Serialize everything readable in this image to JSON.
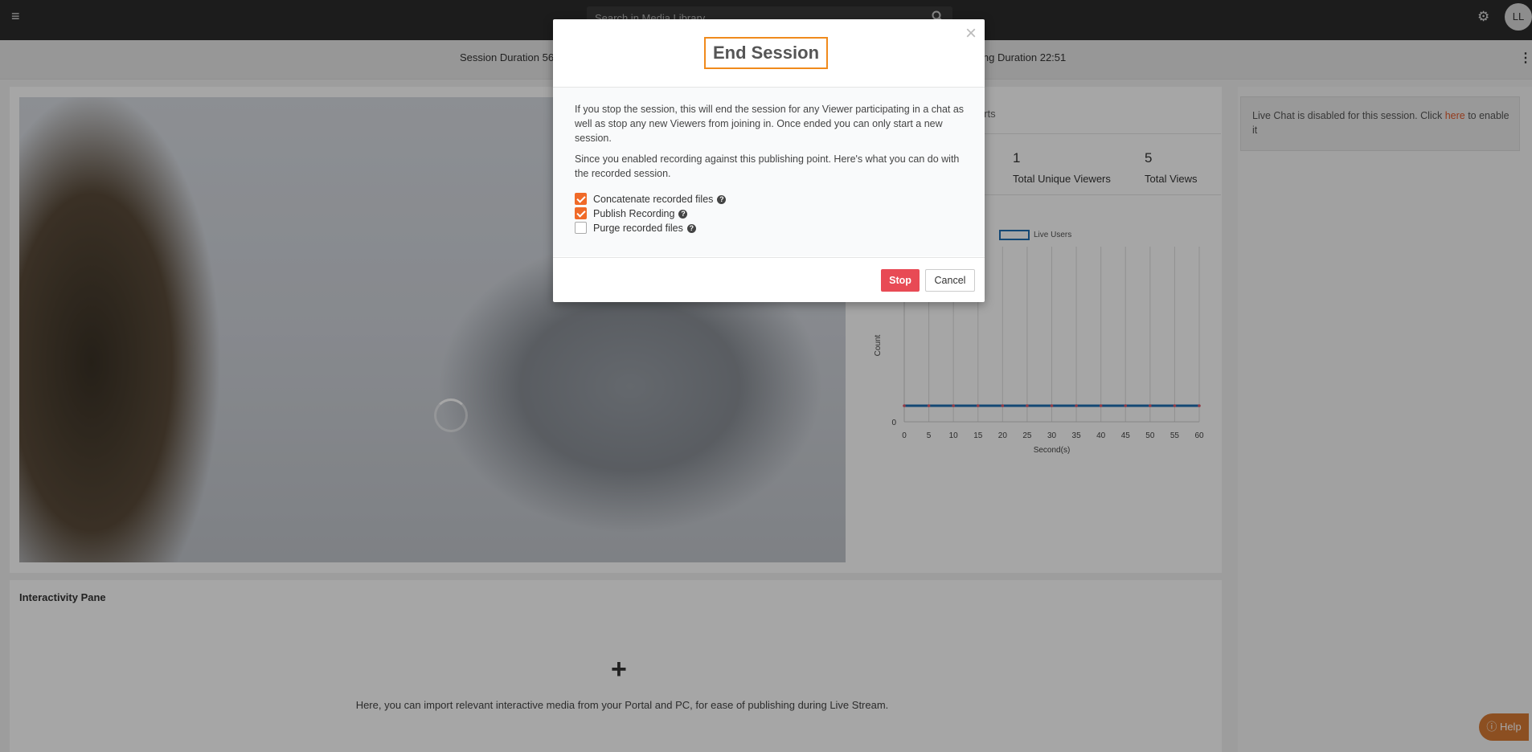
{
  "topbar": {
    "search_placeholder": "Search in Media Library",
    "avatar_initials": "LL"
  },
  "session_bar": {
    "session_duration": "Session Duration 56",
    "streaming_duration": "ing Duration 22:51"
  },
  "stats": {
    "tab_label": "orts",
    "unique_viewers_value": "1",
    "unique_viewers_label": "Total Unique Viewers",
    "total_views_value": "5",
    "total_views_label": "Total Views"
  },
  "chart_data": {
    "type": "line",
    "title": "",
    "xlabel": "Second(s)",
    "ylabel": "Count",
    "x": [
      0,
      5,
      10,
      15,
      20,
      25,
      30,
      35,
      40,
      45,
      50,
      55,
      60
    ],
    "series": [
      {
        "name": "Live Users",
        "values": [
          0,
          0,
          0,
          0,
          0,
          0,
          0,
          0,
          0,
          0,
          0,
          0,
          0
        ]
      }
    ],
    "x_ticks": [
      "0",
      "5",
      "10",
      "15",
      "20",
      "25",
      "30",
      "35",
      "40",
      "45",
      "50",
      "55",
      "60"
    ],
    "y_ticks": [
      "0"
    ],
    "grid": true,
    "legend": "top"
  },
  "chat": {
    "notice_prefix": "Live Chat is disabled for this session. Click ",
    "notice_link": "here",
    "notice_suffix": " to enable it"
  },
  "interactivity": {
    "title": "Interactivity Pane",
    "plus": "+",
    "description": "Here, you can import relevant interactive media from your Portal and PC, for ease of publishing during Live Stream."
  },
  "help": {
    "label": "Help"
  },
  "modal": {
    "title": "End Session",
    "close": "×",
    "paragraph1": "If you stop the session, this will end the session for any Viewer participating in a chat as well as stop any new Viewers from joining in. Once ended you can only start a new session.",
    "paragraph2": "Since you enabled recording against this publishing point. Here's what you can do with the recorded session.",
    "options": [
      {
        "label": "Concatenate recorded files",
        "checked": true
      },
      {
        "label": "Publish Recording",
        "checked": true
      },
      {
        "label": "Purge recorded files",
        "checked": false
      }
    ],
    "stop_label": "Stop",
    "cancel_label": "Cancel"
  },
  "colors": {
    "accent_orange": "#f06a28",
    "stop_red": "#e84a55",
    "series_blue": "#1f6fb2",
    "marker_red": "#e05a6a"
  }
}
